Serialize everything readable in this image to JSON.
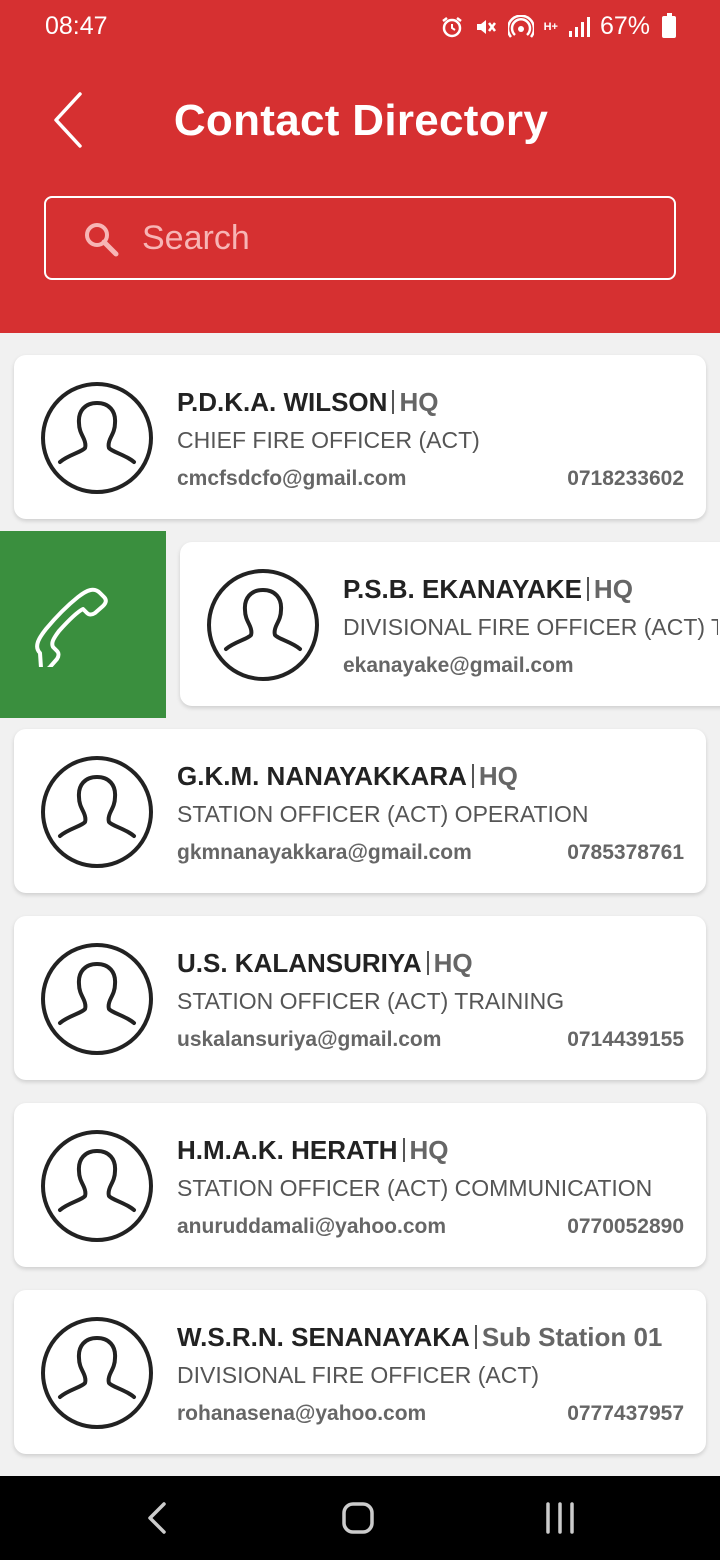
{
  "status_bar": {
    "time": "08:47",
    "battery": "67%",
    "network": "H+",
    "icons": [
      "alarm-icon",
      "mute-icon",
      "hotspot-icon",
      "network-icon",
      "signal-icon",
      "battery-icon"
    ]
  },
  "header": {
    "title": "Contact Directory",
    "back_icon": "chevron-left-icon"
  },
  "search": {
    "placeholder": "Search",
    "value": ""
  },
  "colors": {
    "header": "#d63031",
    "call_action": "#3a8f3e"
  },
  "contacts": [
    {
      "name": "P.D.K.A. WILSON",
      "station": "HQ",
      "position": "CHIEF FIRE OFFICER (ACT)",
      "email": "cmcfsdcfo@gmail.com",
      "phone": "0718233602"
    },
    {
      "name": "P.S.B. EKANAYAKE",
      "station": "HQ",
      "position": "DIVISIONAL FIRE OFFICER (ACT) TRAINING",
      "email": "ekanayake@gmail.com",
      "phone": ""
    },
    {
      "name": "G.K.M. NANAYAKKARA",
      "station": "HQ",
      "position": "STATION OFFICER (ACT) OPERATION",
      "email": "gkmnanayakkara@gmail.com",
      "phone": "0785378761"
    },
    {
      "name": "U.S. KALANSURIYA",
      "station": "HQ",
      "position": "STATION OFFICER (ACT) TRAINING",
      "email": "uskalansuriya@gmail.com",
      "phone": "0714439155"
    },
    {
      "name": "H.M.A.K. HERATH",
      "station": "HQ",
      "position": "STATION OFFICER (ACT) COMMUNICATION",
      "email": "anuruddamali@yahoo.com",
      "phone": "0770052890"
    },
    {
      "name": "W.S.R.N. SENANAYAKA",
      "station": "Sub Station 01",
      "position": "DIVISIONAL FIRE OFFICER (ACT)",
      "email": "rohanasena@yahoo.com",
      "phone": "0777437957"
    }
  ],
  "swipe_action": {
    "icon": "phone-icon",
    "row": 1
  },
  "nav": {
    "buttons": [
      "back-nav-icon",
      "home-nav-icon",
      "recents-nav-icon"
    ]
  }
}
